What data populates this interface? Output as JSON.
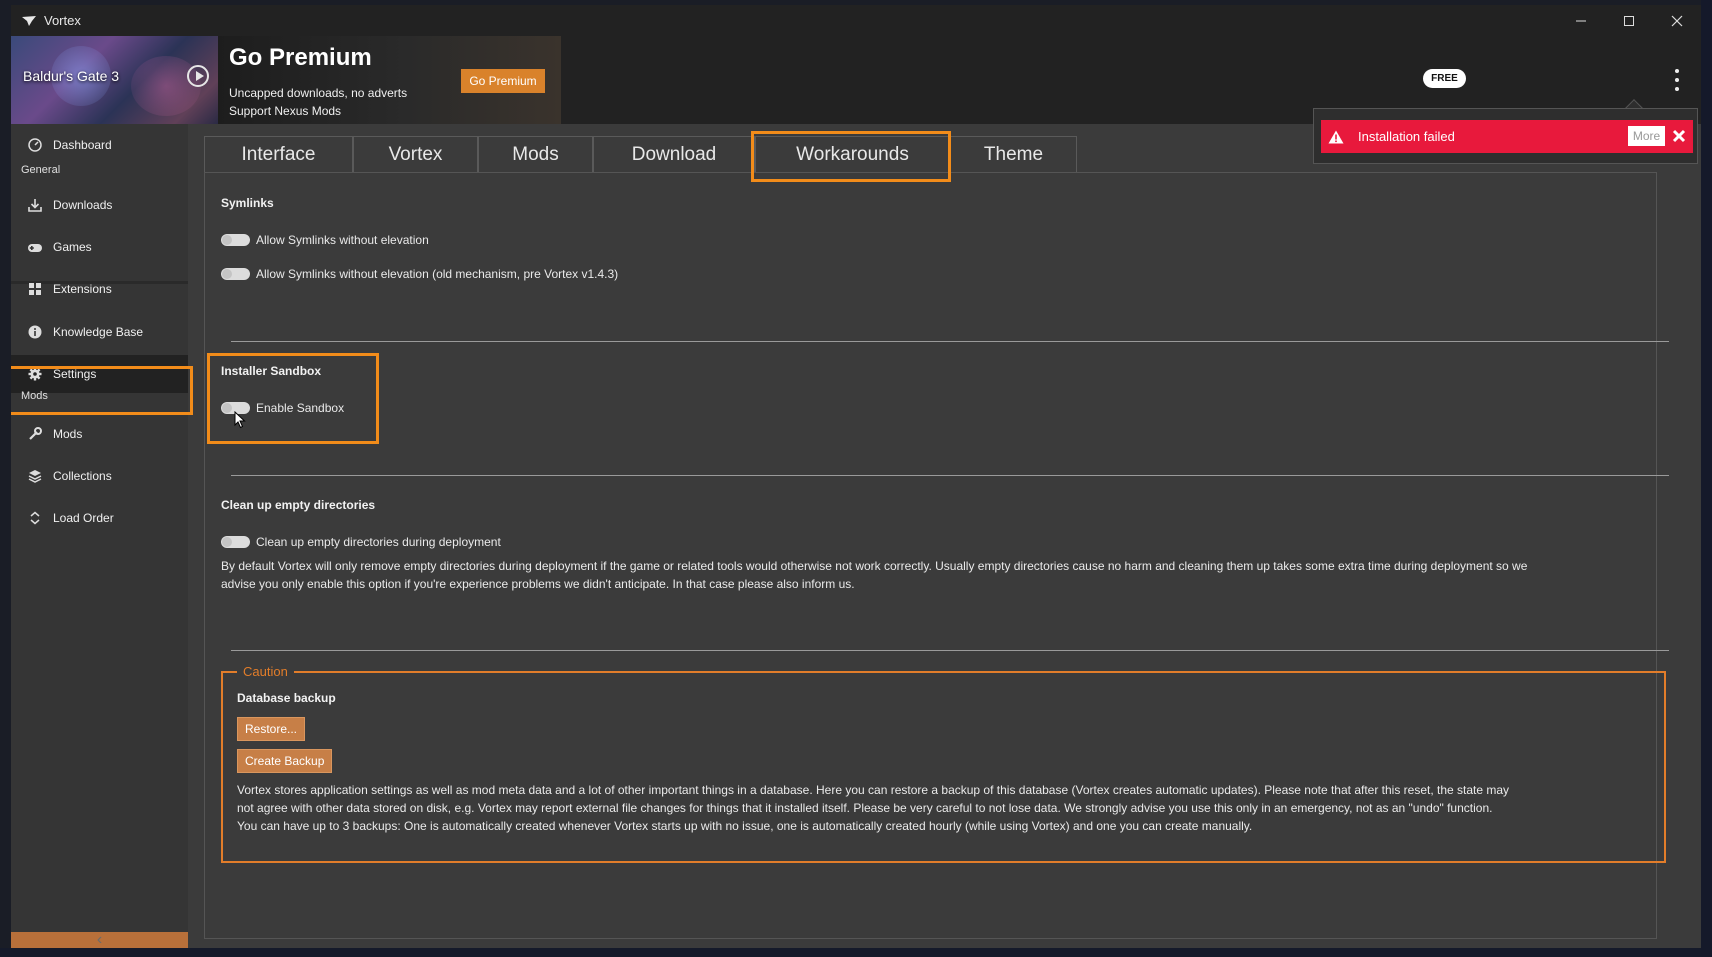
{
  "window": {
    "title": "Vortex"
  },
  "banner": {
    "game_name": "Baldur's Gate 3",
    "premium_title": "Go Premium",
    "premium_line1": "Uncapped downloads, no adverts",
    "premium_line2": "Support Nexus Mods",
    "premium_button": "Go Premium",
    "badge": "FREE"
  },
  "notification": {
    "message": "Installation failed",
    "more": "More"
  },
  "sidebar": {
    "items": [
      {
        "label": "Dashboard",
        "icon": "dashboard-icon"
      },
      {
        "label": "Downloads",
        "icon": "download-icon"
      },
      {
        "label": "Games",
        "icon": "gamepad-icon"
      },
      {
        "label": "Extensions",
        "icon": "extensions-icon"
      },
      {
        "label": "Knowledge Base",
        "icon": "info-icon"
      },
      {
        "label": "Settings",
        "icon": "gear-icon",
        "selected": true
      },
      {
        "label": "Mods",
        "icon": "wrench-icon"
      },
      {
        "label": "Collections",
        "icon": "layers-icon"
      },
      {
        "label": "Load Order",
        "icon": "sort-icon"
      }
    ],
    "sections": {
      "general": "General",
      "mods": "Mods"
    }
  },
  "tabs": [
    {
      "label": "Interface"
    },
    {
      "label": "Vortex"
    },
    {
      "label": "Mods"
    },
    {
      "label": "Download"
    },
    {
      "label": "Workarounds",
      "active": true
    },
    {
      "label": "Theme"
    }
  ],
  "settings": {
    "symlinks": {
      "title": "Symlinks",
      "toggle1": "Allow Symlinks without elevation",
      "toggle2": "Allow Symlinks without elevation (old mechanism, pre Vortex v1.4.3)"
    },
    "sandbox": {
      "title": "Installer Sandbox",
      "toggle": "Enable Sandbox"
    },
    "cleanup": {
      "title": "Clean up empty directories",
      "toggle": "Clean up empty directories during deployment",
      "desc_line1": "By default Vortex will only remove empty directories during deployment if the game or related tools would otherwise not work correctly. Usually empty directories cause no harm and cleaning them up takes some extra time during deployment so we",
      "desc_line2": "advise you only enable this option if you're experience problems we didn't anticipate. In that case please also inform us."
    },
    "caution": {
      "legend": "Caution",
      "title": "Database backup",
      "restore_button": "Restore...",
      "backup_button": "Create Backup",
      "desc_line1": "Vortex stores application settings as well as mod meta data and a lot of other important things in a database. Here you can restore a backup of this database (Vortex creates automatic updates). Please note that after this reset, the state may",
      "desc_line2": "not agree with other data stored on disk, e.g. Vortex may report external file changes for things that it installed itself. Please be very careful to not lose data. We strongly advise you use this only in an emergency, not as an \"undo\" function.",
      "desc_line3": "You can have up to 3 backups: One is automatically created whenever Vortex starts up with no issue, one is automatically created hourly (while using Vortex) and one you can create manually."
    }
  },
  "colors": {
    "accent": "#d9822b",
    "highlight": "#f28c1a",
    "notification": "#e8193c",
    "background": "#3b3b3b",
    "sidebar": "#353535"
  }
}
